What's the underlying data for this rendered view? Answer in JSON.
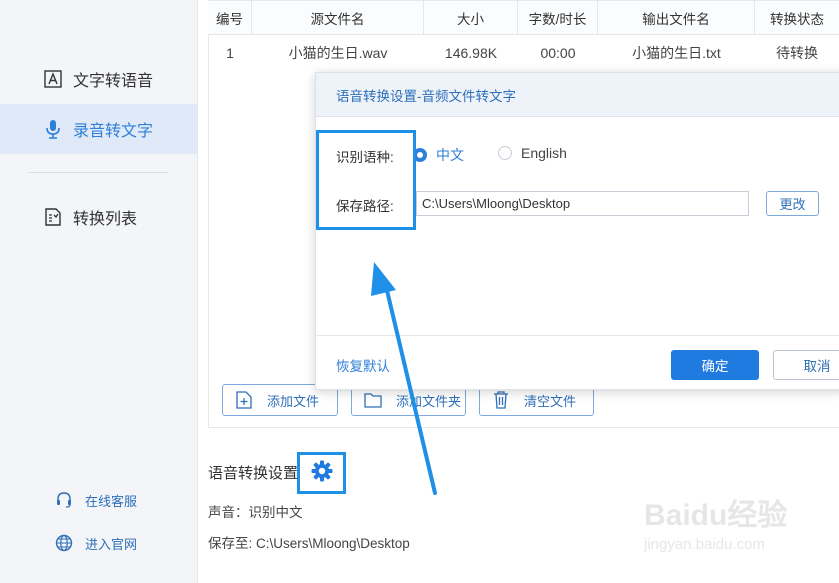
{
  "sidebar": {
    "items": [
      {
        "label": "文字转语音",
        "icon": "text-to-speech-icon"
      },
      {
        "label": "录音转文字",
        "icon": "microphone-icon"
      },
      {
        "label": "转换列表",
        "icon": "list-icon"
      }
    ],
    "links": [
      {
        "label": "在线客服",
        "icon": "headset-icon"
      },
      {
        "label": "进入官网",
        "icon": "globe-icon"
      }
    ]
  },
  "table": {
    "headers": [
      "编号",
      "源文件名",
      "大小",
      "字数/时长",
      "输出文件名",
      "转换状态"
    ],
    "rows": [
      [
        "1",
        "小猫的生日.wav",
        "146.98K",
        "00:00",
        "小猫的生日.txt",
        "待转换"
      ]
    ]
  },
  "actions": {
    "add_file": "添加文件",
    "add_folder": "添加文件夹",
    "clear_files": "清空文件"
  },
  "settings": {
    "title": "语音转换设置",
    "voice_line": "声音：识别中文",
    "save_line": "保存至: C:\\Users\\Mloong\\Desktop"
  },
  "dialog": {
    "title": "语音转换设置-音频文件转文字",
    "lang_label": "识别语种:",
    "lang_options": [
      "中文",
      "English"
    ],
    "lang_selected": "中文",
    "path_label": "保存路径:",
    "path_value": "C:\\Users\\Mloong\\Desktop",
    "change_label": "更改",
    "restore_label": "恢复默认",
    "ok_label": "确定",
    "cancel_label": "取消"
  },
  "watermark": {
    "main": "Baidu经验",
    "sub": "jingyan.baidu.com"
  },
  "colors": {
    "accent": "#2e7fd9",
    "highlight": "#1e90e8",
    "primary_button": "#1f7be0"
  }
}
